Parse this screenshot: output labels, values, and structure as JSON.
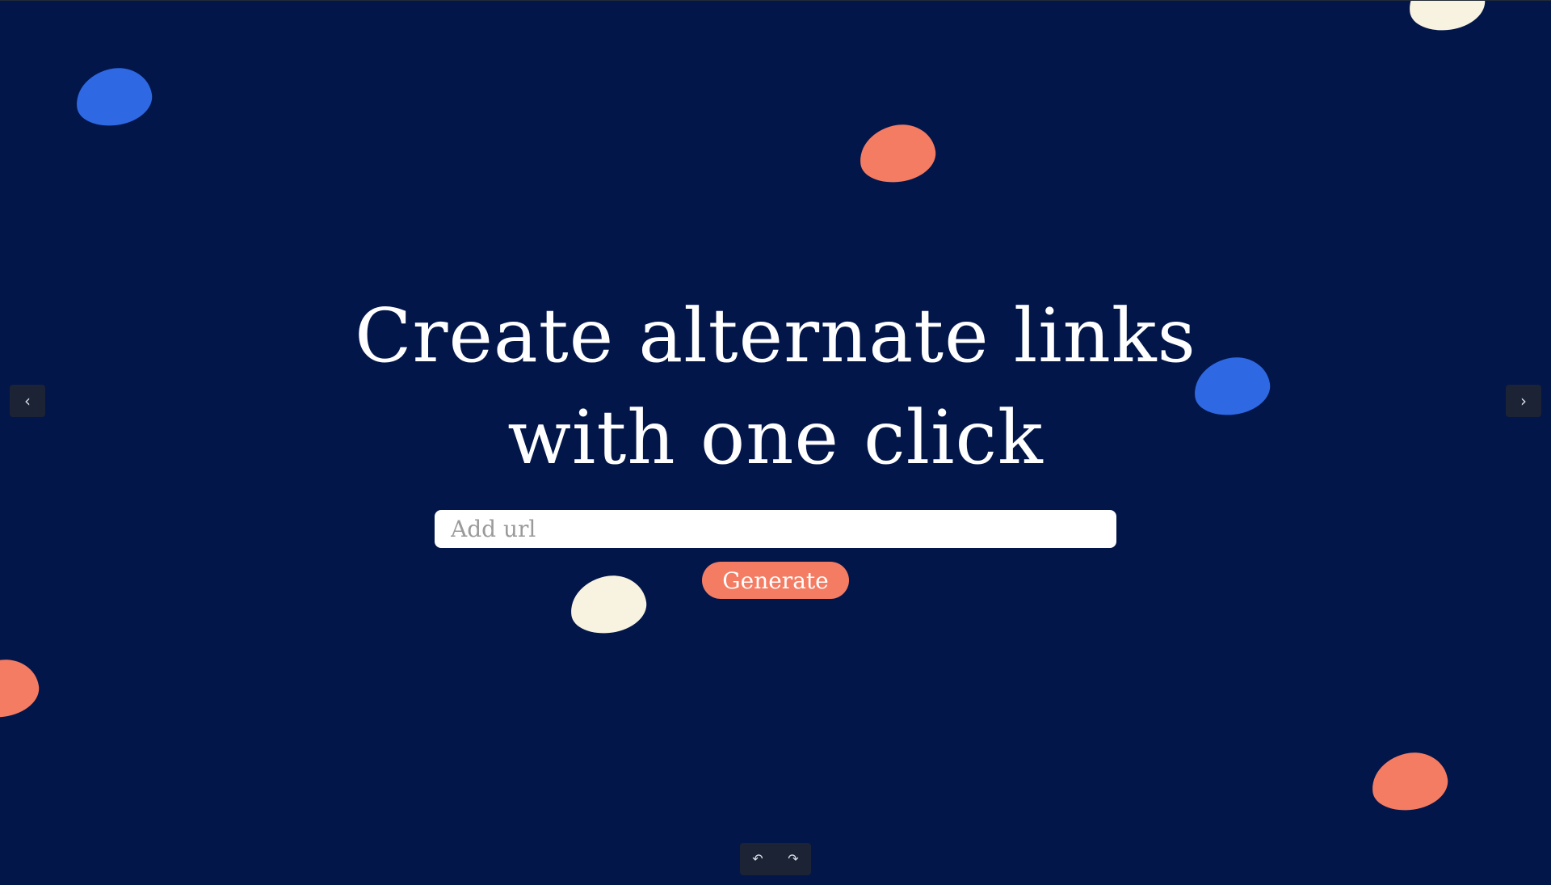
{
  "hero": {
    "headline_line1": "Create alternate links",
    "headline_line2": "with one click"
  },
  "form": {
    "url_placeholder": "Add url",
    "url_value": "",
    "generate_label": "Generate"
  },
  "navigation": {
    "prev_icon": "‹",
    "next_icon": "›"
  },
  "toolbar": {
    "undo_icon": "↶",
    "redo_icon": "↷"
  },
  "colors": {
    "background": "#03164a",
    "blob_blue": "#2e69e3",
    "blob_coral": "#f47c63",
    "blob_cream": "#f8f3e0",
    "button": "#f47c63"
  }
}
